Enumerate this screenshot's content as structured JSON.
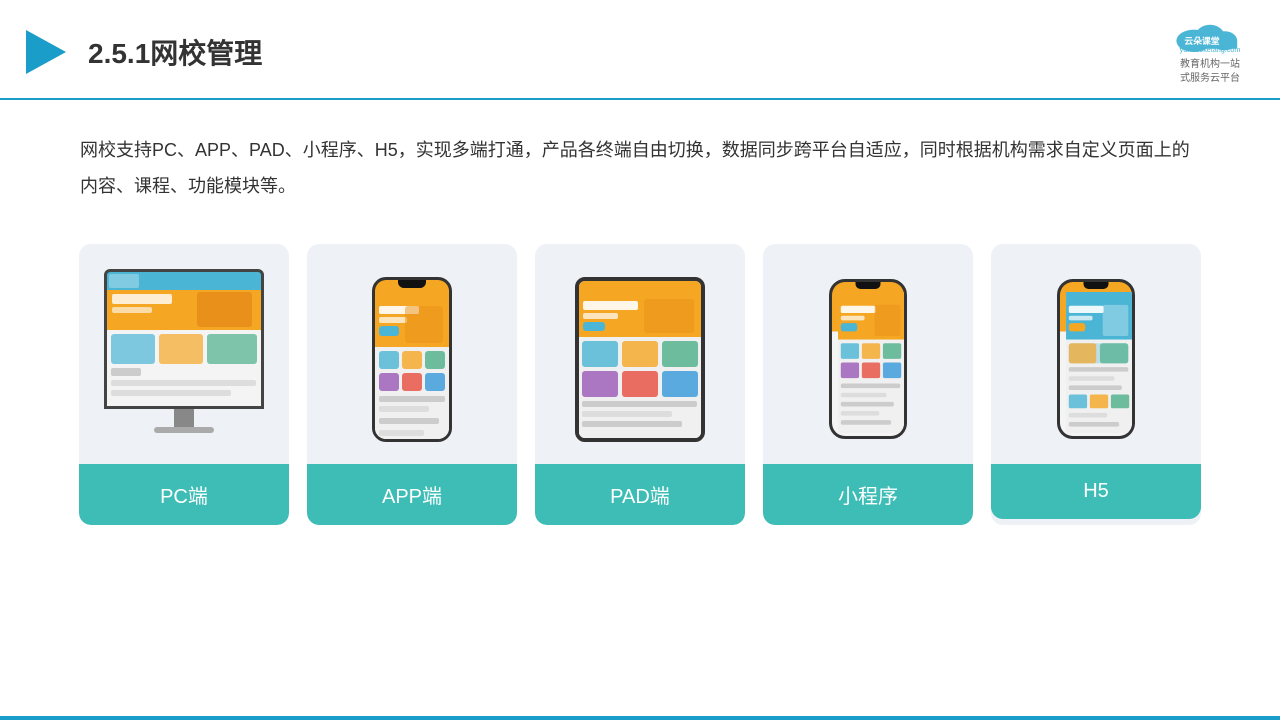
{
  "header": {
    "title": "2.5.1网校管理",
    "logo_name": "云朵课堂",
    "logo_subtitle": "教育机构一站\n式服务云平台",
    "logo_url": "yunduoketang.com"
  },
  "description": {
    "text": "网校支持PC、APP、PAD、小程序、H5，实现多端打通，产品各终端自由切换，数据同步跨平台自适应，同时根据机构需求自定义页面上的内容、课程、功能模块等。"
  },
  "cards": [
    {
      "id": "pc",
      "label": "PC端"
    },
    {
      "id": "app",
      "label": "APP端"
    },
    {
      "id": "pad",
      "label": "PAD端"
    },
    {
      "id": "miniprogram",
      "label": "小程序"
    },
    {
      "id": "h5",
      "label": "H5"
    }
  ],
  "colors": {
    "accent": "#1a9dc8",
    "teal": "#3dbdb5",
    "card_bg": "#eef2f7"
  }
}
